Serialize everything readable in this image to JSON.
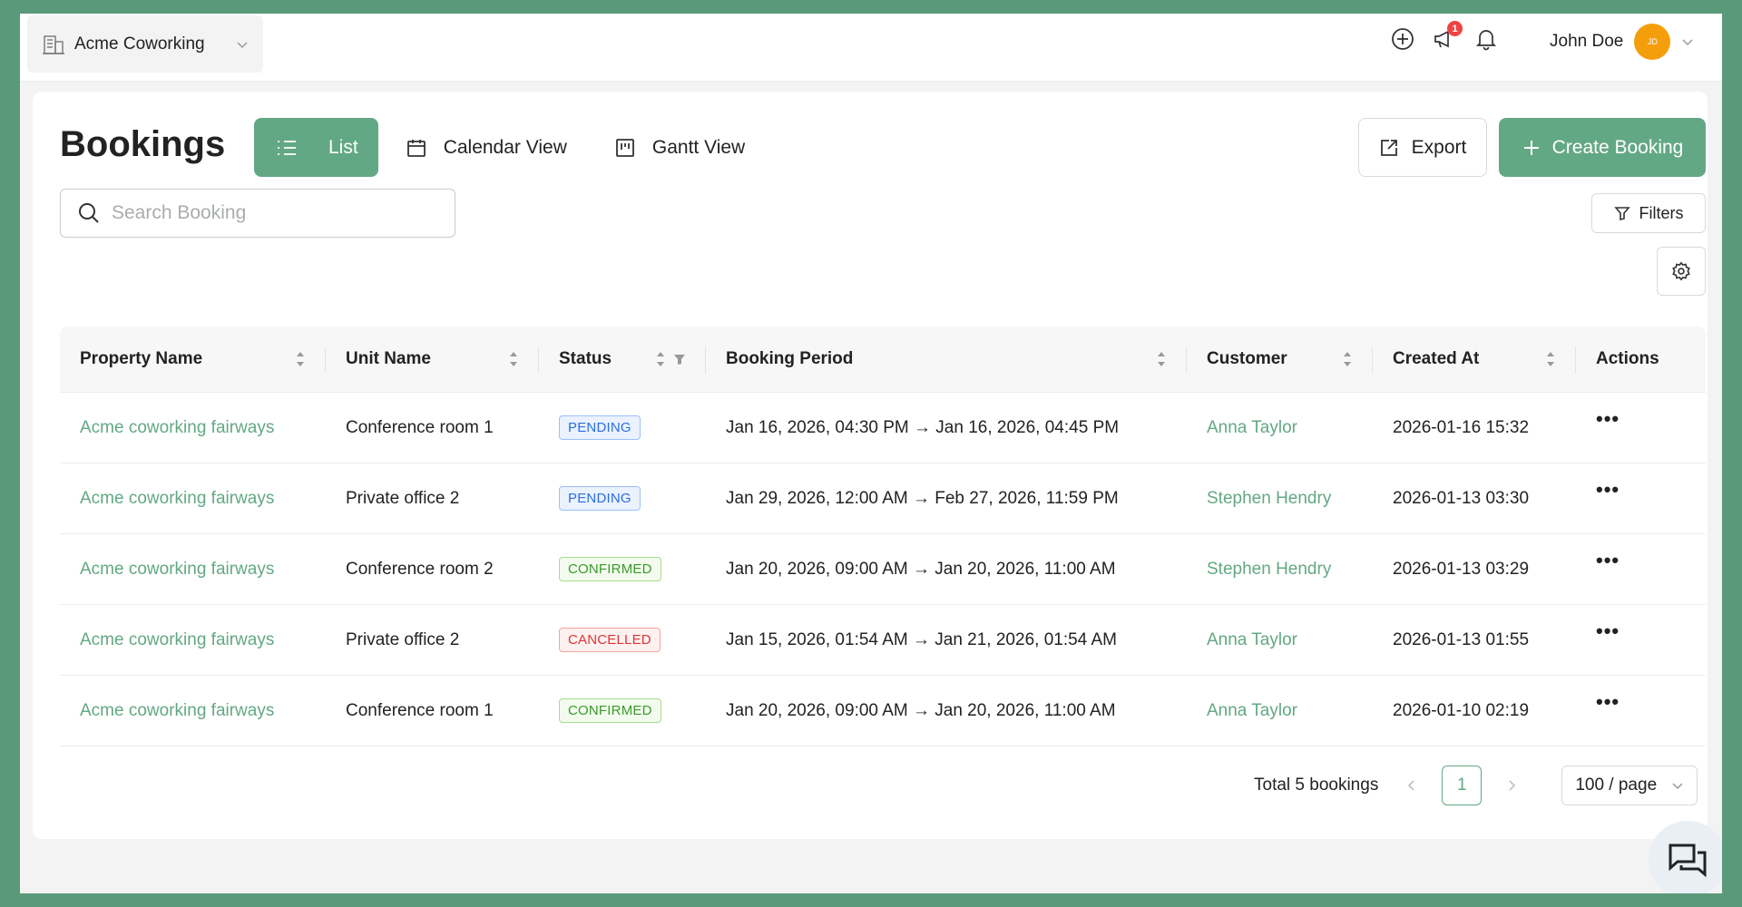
{
  "topbar": {
    "workspace": "Acme Coworking",
    "notification_count": "1",
    "user_name": "John Doe",
    "avatar_initials": "JD"
  },
  "page": {
    "title": "Bookings",
    "views": [
      {
        "label": "List",
        "active": true
      },
      {
        "label": "Calendar View",
        "active": false
      },
      {
        "label": "Gantt View",
        "active": false
      }
    ],
    "export_label": "Export",
    "create_label": "Create Booking",
    "search_placeholder": "Search Booking",
    "filters_label": "Filters"
  },
  "table": {
    "columns": [
      "Property Name",
      "Unit Name",
      "Status",
      "Booking Period",
      "Customer",
      "Created At",
      "Actions"
    ],
    "rows": [
      {
        "property": "Acme coworking fairways",
        "unit": "Conference room 1",
        "status": "PENDING",
        "period": "Jan 16, 2026, 04:30 PM → Jan 16, 2026, 04:45 PM",
        "customer": "Anna Taylor",
        "created": "2026-01-16 15:32",
        "actions": "•••"
      },
      {
        "property": "Acme coworking fairways",
        "unit": "Private office 2",
        "status": "PENDING",
        "period": "Jan 29, 2026, 12:00 AM → Feb 27, 2026, 11:59 PM",
        "customer": "Stephen Hendry",
        "created": "2026-01-13 03:30",
        "actions": "•••"
      },
      {
        "property": "Acme coworking fairways",
        "unit": "Conference room 2",
        "status": "CONFIRMED",
        "period": "Jan 20, 2026, 09:00 AM → Jan 20, 2026, 11:00 AM",
        "customer": "Stephen Hendry",
        "created": "2026-01-13 03:29",
        "actions": "•••"
      },
      {
        "property": "Acme coworking fairways",
        "unit": "Private office 2",
        "status": "CANCELLED",
        "period": "Jan 15, 2026, 01:54 AM → Jan 21, 2026, 01:54 AM",
        "customer": "Anna Taylor",
        "created": "2026-01-13 01:55",
        "actions": "•••"
      },
      {
        "property": "Acme coworking fairways",
        "unit": "Conference room 1",
        "status": "CONFIRMED",
        "period": "Jan 20, 2026, 09:00 AM → Jan 20, 2026, 11:00 AM",
        "customer": "Anna Taylor",
        "created": "2026-01-10 02:19",
        "actions": "•••"
      }
    ]
  },
  "pagination": {
    "total_label": "Total 5 bookings",
    "current_page": "1",
    "page_size": "100 / page"
  },
  "colors": {
    "accent": "#63a884",
    "frame": "#5a9a7a",
    "pending": "#2d6cdf",
    "confirmed": "#3a9a2a",
    "cancelled": "#d93636"
  }
}
